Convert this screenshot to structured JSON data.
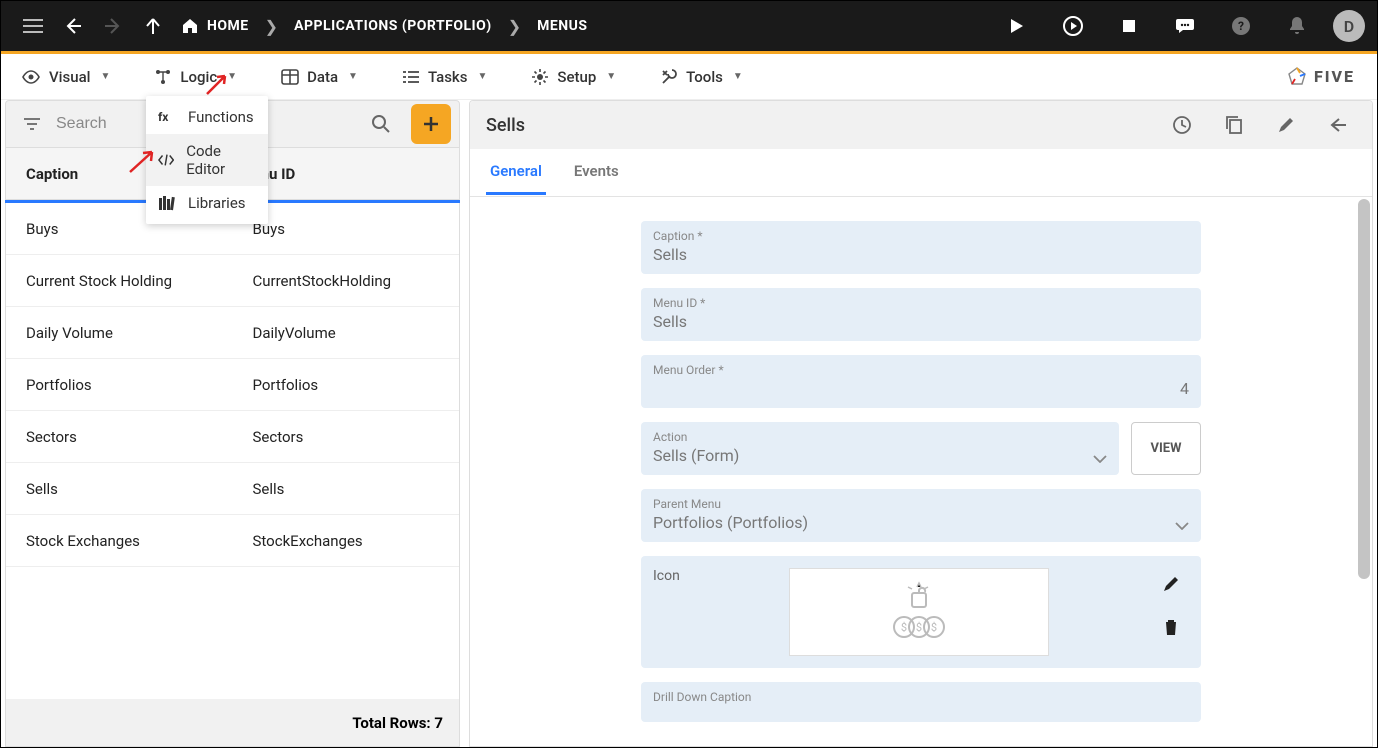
{
  "topbar": {
    "home": "HOME",
    "breadcrumb1": "APPLICATIONS (PORTFOLIO)",
    "breadcrumb2": "MENUS",
    "avatar_initial": "D"
  },
  "menubar": {
    "visual": "Visual",
    "logic": "Logic",
    "data": "Data",
    "tasks": "Tasks",
    "setup": "Setup",
    "tools": "Tools",
    "brand": "FIVE"
  },
  "logic_dropdown": {
    "functions": "Functions",
    "code_editor": "Code Editor",
    "libraries": "Libraries"
  },
  "left": {
    "search_placeholder": "Search",
    "col_caption": "Caption",
    "col_menuid": "enu ID",
    "rows": [
      {
        "caption": "Buys",
        "menuid": "Buys"
      },
      {
        "caption": "Current Stock Holding",
        "menuid": "CurrentStockHolding"
      },
      {
        "caption": "Daily Volume",
        "menuid": "DailyVolume"
      },
      {
        "caption": "Portfolios",
        "menuid": "Portfolios"
      },
      {
        "caption": "Sectors",
        "menuid": "Sectors"
      },
      {
        "caption": "Sells",
        "menuid": "Sells"
      },
      {
        "caption": "Stock Exchanges",
        "menuid": "StockExchanges"
      }
    ],
    "footer": "Total Rows: 7"
  },
  "right": {
    "title": "Sells",
    "tabs": {
      "general": "General",
      "events": "Events"
    },
    "form": {
      "caption_label": "Caption *",
      "caption_value": "Sells",
      "menuid_label": "Menu ID *",
      "menuid_value": "Sells",
      "menuorder_label": "Menu Order *",
      "menuorder_value": "4",
      "action_label": "Action",
      "action_value": "Sells (Form)",
      "view_btn": "VIEW",
      "parent_label": "Parent Menu",
      "parent_value": "Portfolios (Portfolios)",
      "icon_label": "Icon",
      "drilldown_label": "Drill Down Caption"
    }
  }
}
